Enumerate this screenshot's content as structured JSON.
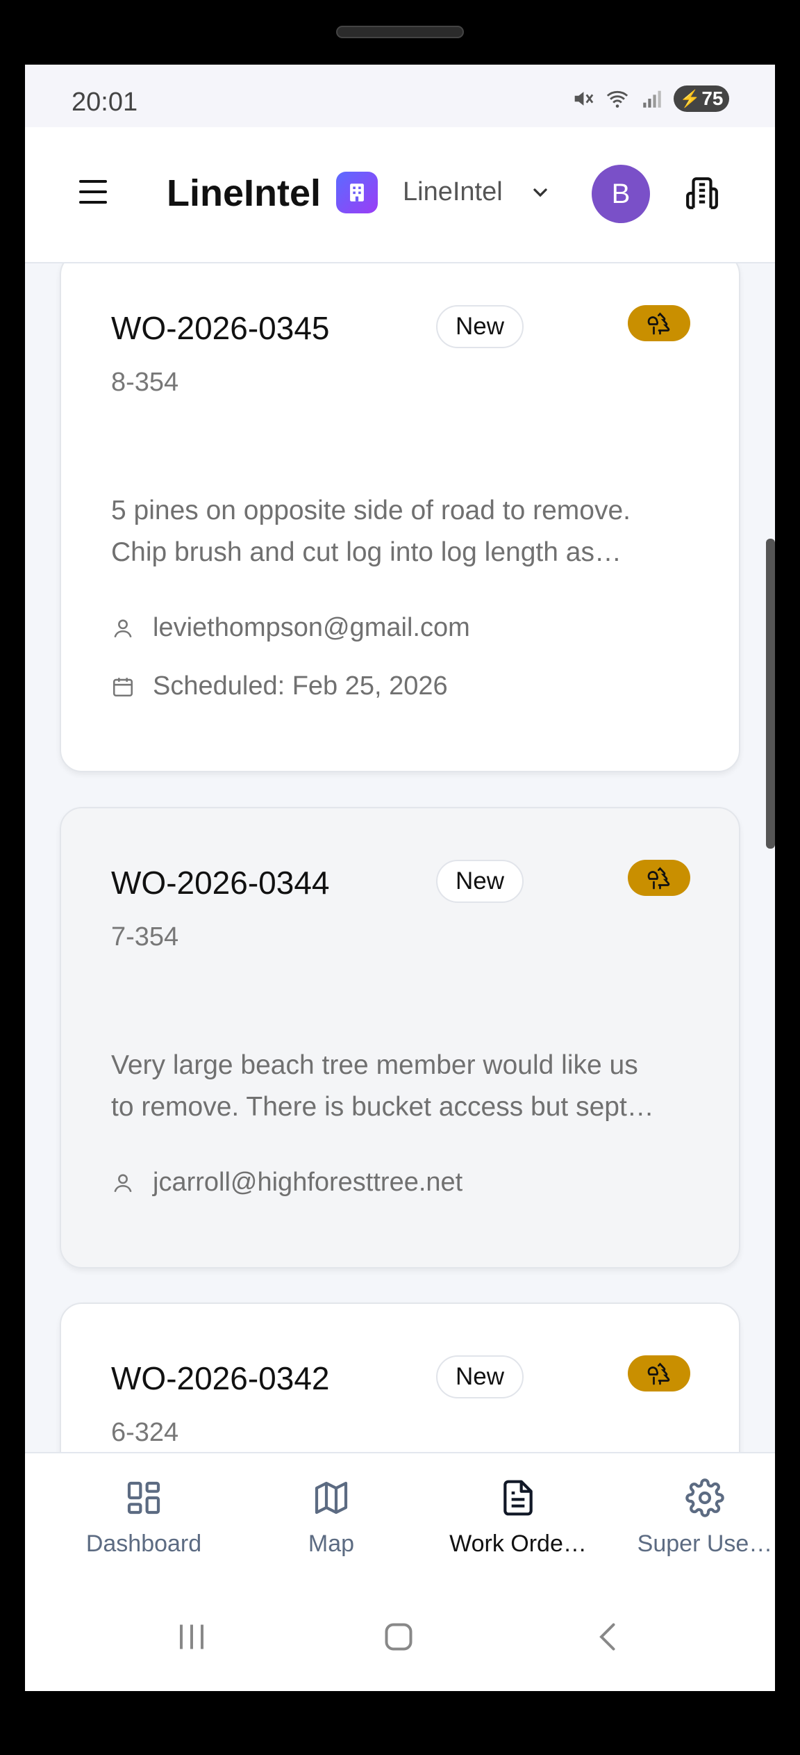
{
  "status_bar": {
    "time": "20:01",
    "battery": "75"
  },
  "app_bar": {
    "brand": "LineIntel",
    "org_name": "LineIntel",
    "avatar_initial": "B"
  },
  "work_orders": [
    {
      "id": "WO-2026-0345",
      "status": "New",
      "code": "8-354",
      "description_lines": [
        "5 pines on opposite side of road to remove.",
        "Chip brush and cut log into log length as…"
      ],
      "assignee": "leviethompson@gmail.com",
      "scheduled": "Scheduled: Feb 25, 2026"
    },
    {
      "id": "WO-2026-0344",
      "status": "New",
      "code": "7-354",
      "description_lines": [
        "Very large beach tree member would like us",
        "to remove. There is bucket access but sept…"
      ],
      "assignee": "jcarroll@highforesttree.net"
    },
    {
      "id": "WO-2026-0342",
      "status": "New",
      "code": "6-324"
    }
  ],
  "bottom_nav": [
    {
      "label": "Dashboard",
      "icon": "dashboard-icon"
    },
    {
      "label": "Map",
      "icon": "map-icon"
    },
    {
      "label": "Work Orde…",
      "icon": "document-icon",
      "active": true
    },
    {
      "label": "Super Use…",
      "icon": "gear-icon"
    }
  ],
  "colors": {
    "accent_tree": "#c98f00",
    "avatar": "#7a50c8",
    "nav_inactive": "#5c6b82"
  }
}
